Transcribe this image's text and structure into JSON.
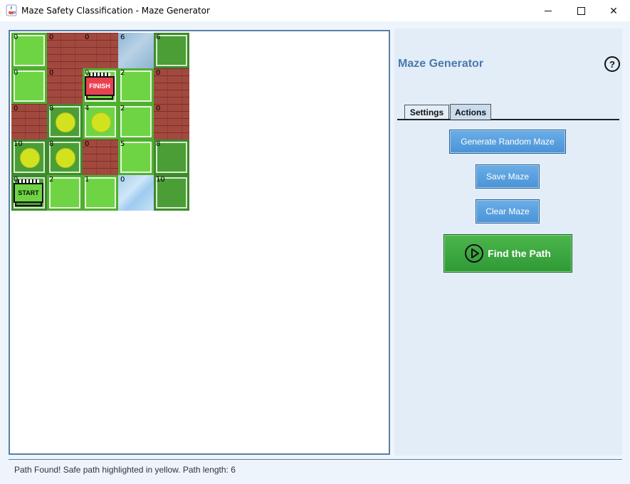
{
  "window": {
    "title": "Maze Safety Classification - Maze Generator",
    "controls": {
      "minimize": "—",
      "close": "✕"
    }
  },
  "maze": {
    "rows": [
      [
        {
          "value": "0",
          "terrain": "grass"
        },
        {
          "value": "0",
          "terrain": "brick"
        },
        {
          "value": "0",
          "terrain": "brick"
        },
        {
          "value": "6",
          "terrain": "water-dark"
        },
        {
          "value": "6",
          "terrain": "grass-dark"
        }
      ],
      [
        {
          "value": "0",
          "terrain": "grass"
        },
        {
          "value": "0",
          "terrain": "brick"
        },
        {
          "value": "0",
          "terrain": "grass",
          "sign": "FINISH"
        },
        {
          "value": "2",
          "terrain": "grass"
        },
        {
          "value": "0",
          "terrain": "brick"
        }
      ],
      [
        {
          "value": "0",
          "terrain": "brick"
        },
        {
          "value": "8",
          "terrain": "grass-dark",
          "path": true
        },
        {
          "value": "4",
          "terrain": "grass",
          "path": true
        },
        {
          "value": "2",
          "terrain": "grass"
        },
        {
          "value": "0",
          "terrain": "brick"
        }
      ],
      [
        {
          "value": "10",
          "terrain": "grass-dark",
          "path": true
        },
        {
          "value": "8",
          "terrain": "grass-dark",
          "path": true
        },
        {
          "value": "0",
          "terrain": "brick"
        },
        {
          "value": "5",
          "terrain": "grass"
        },
        {
          "value": "8",
          "terrain": "grass-dark"
        }
      ],
      [
        {
          "value": "0",
          "terrain": "grass-dark",
          "sign": "START"
        },
        {
          "value": "2",
          "terrain": "grass"
        },
        {
          "value": "1",
          "terrain": "grass"
        },
        {
          "value": "0",
          "terrain": "water"
        },
        {
          "value": "10",
          "terrain": "grass-dark"
        }
      ]
    ]
  },
  "panel": {
    "title": "Maze Generator",
    "help_label": "?",
    "tabs": [
      "Settings",
      "Actions"
    ],
    "active_tab": "Actions",
    "buttons": {
      "generate": "Generate Random Maze",
      "save": "Save Maze",
      "clear": "Clear Maze",
      "find": "Find the Path"
    }
  },
  "status": {
    "message": "Path Found! Safe path highlighted in yellow. Path length: 6"
  },
  "colors": {
    "accent": "#4a7aab",
    "path_highlight": "#d2e21f",
    "find_button": "#3aa53f",
    "finish_sign": "#e8414e",
    "start_sign": "#6fd444"
  },
  "icons": {
    "app": "java-cup-icon",
    "help": "question-circle-icon",
    "find": "play-circle-icon"
  }
}
